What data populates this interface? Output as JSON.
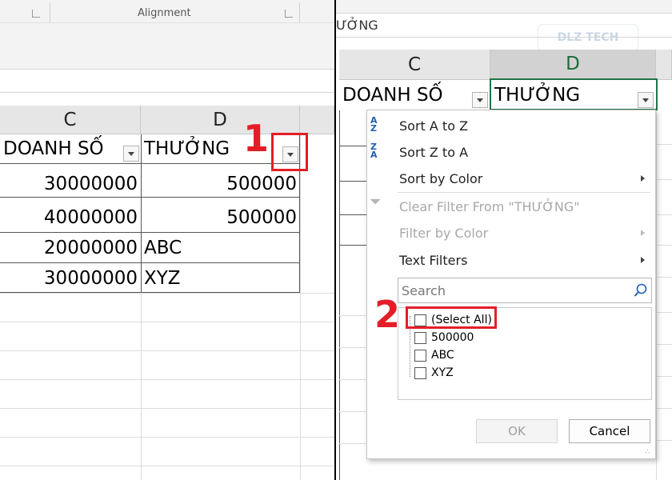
{
  "left": {
    "ribbon": {
      "group_label": "Alignment"
    },
    "columns": {
      "c": "C",
      "d": "D"
    },
    "headers": {
      "doanh_so": "DOANH SỐ",
      "thuong": "THƯỞNG"
    },
    "rows": [
      {
        "doanh_so": "30000000",
        "thuong": "500000"
      },
      {
        "doanh_so": "40000000",
        "thuong": "500000"
      },
      {
        "doanh_so": "20000000",
        "thuong": "ABC"
      },
      {
        "doanh_so": "30000000",
        "thuong": "XYZ"
      }
    ],
    "callout": "1"
  },
  "right": {
    "formula_text": "ƯỞNG",
    "watermark": "DLZ TECH",
    "columns": {
      "c": "C",
      "d": "D"
    },
    "headers": {
      "doanh_so": "DOANH SỐ",
      "thuong": "THƯỞNG"
    },
    "menu": {
      "sort_az": "Sort A to Z",
      "sort_za": "Sort Z to A",
      "sort_color": "Sort by Color",
      "clear_filter": "Clear Filter From \"THƯỞNG\"",
      "filter_color": "Filter by Color",
      "text_filters": "Text Filters",
      "search_placeholder": "Search",
      "items": [
        "(Select All)",
        "500000",
        "ABC",
        "XYZ"
      ],
      "ok": "OK",
      "cancel": "Cancel"
    },
    "callout": "2"
  },
  "colors": {
    "accent_red": "#e41e26",
    "excel_green": "#217346"
  }
}
